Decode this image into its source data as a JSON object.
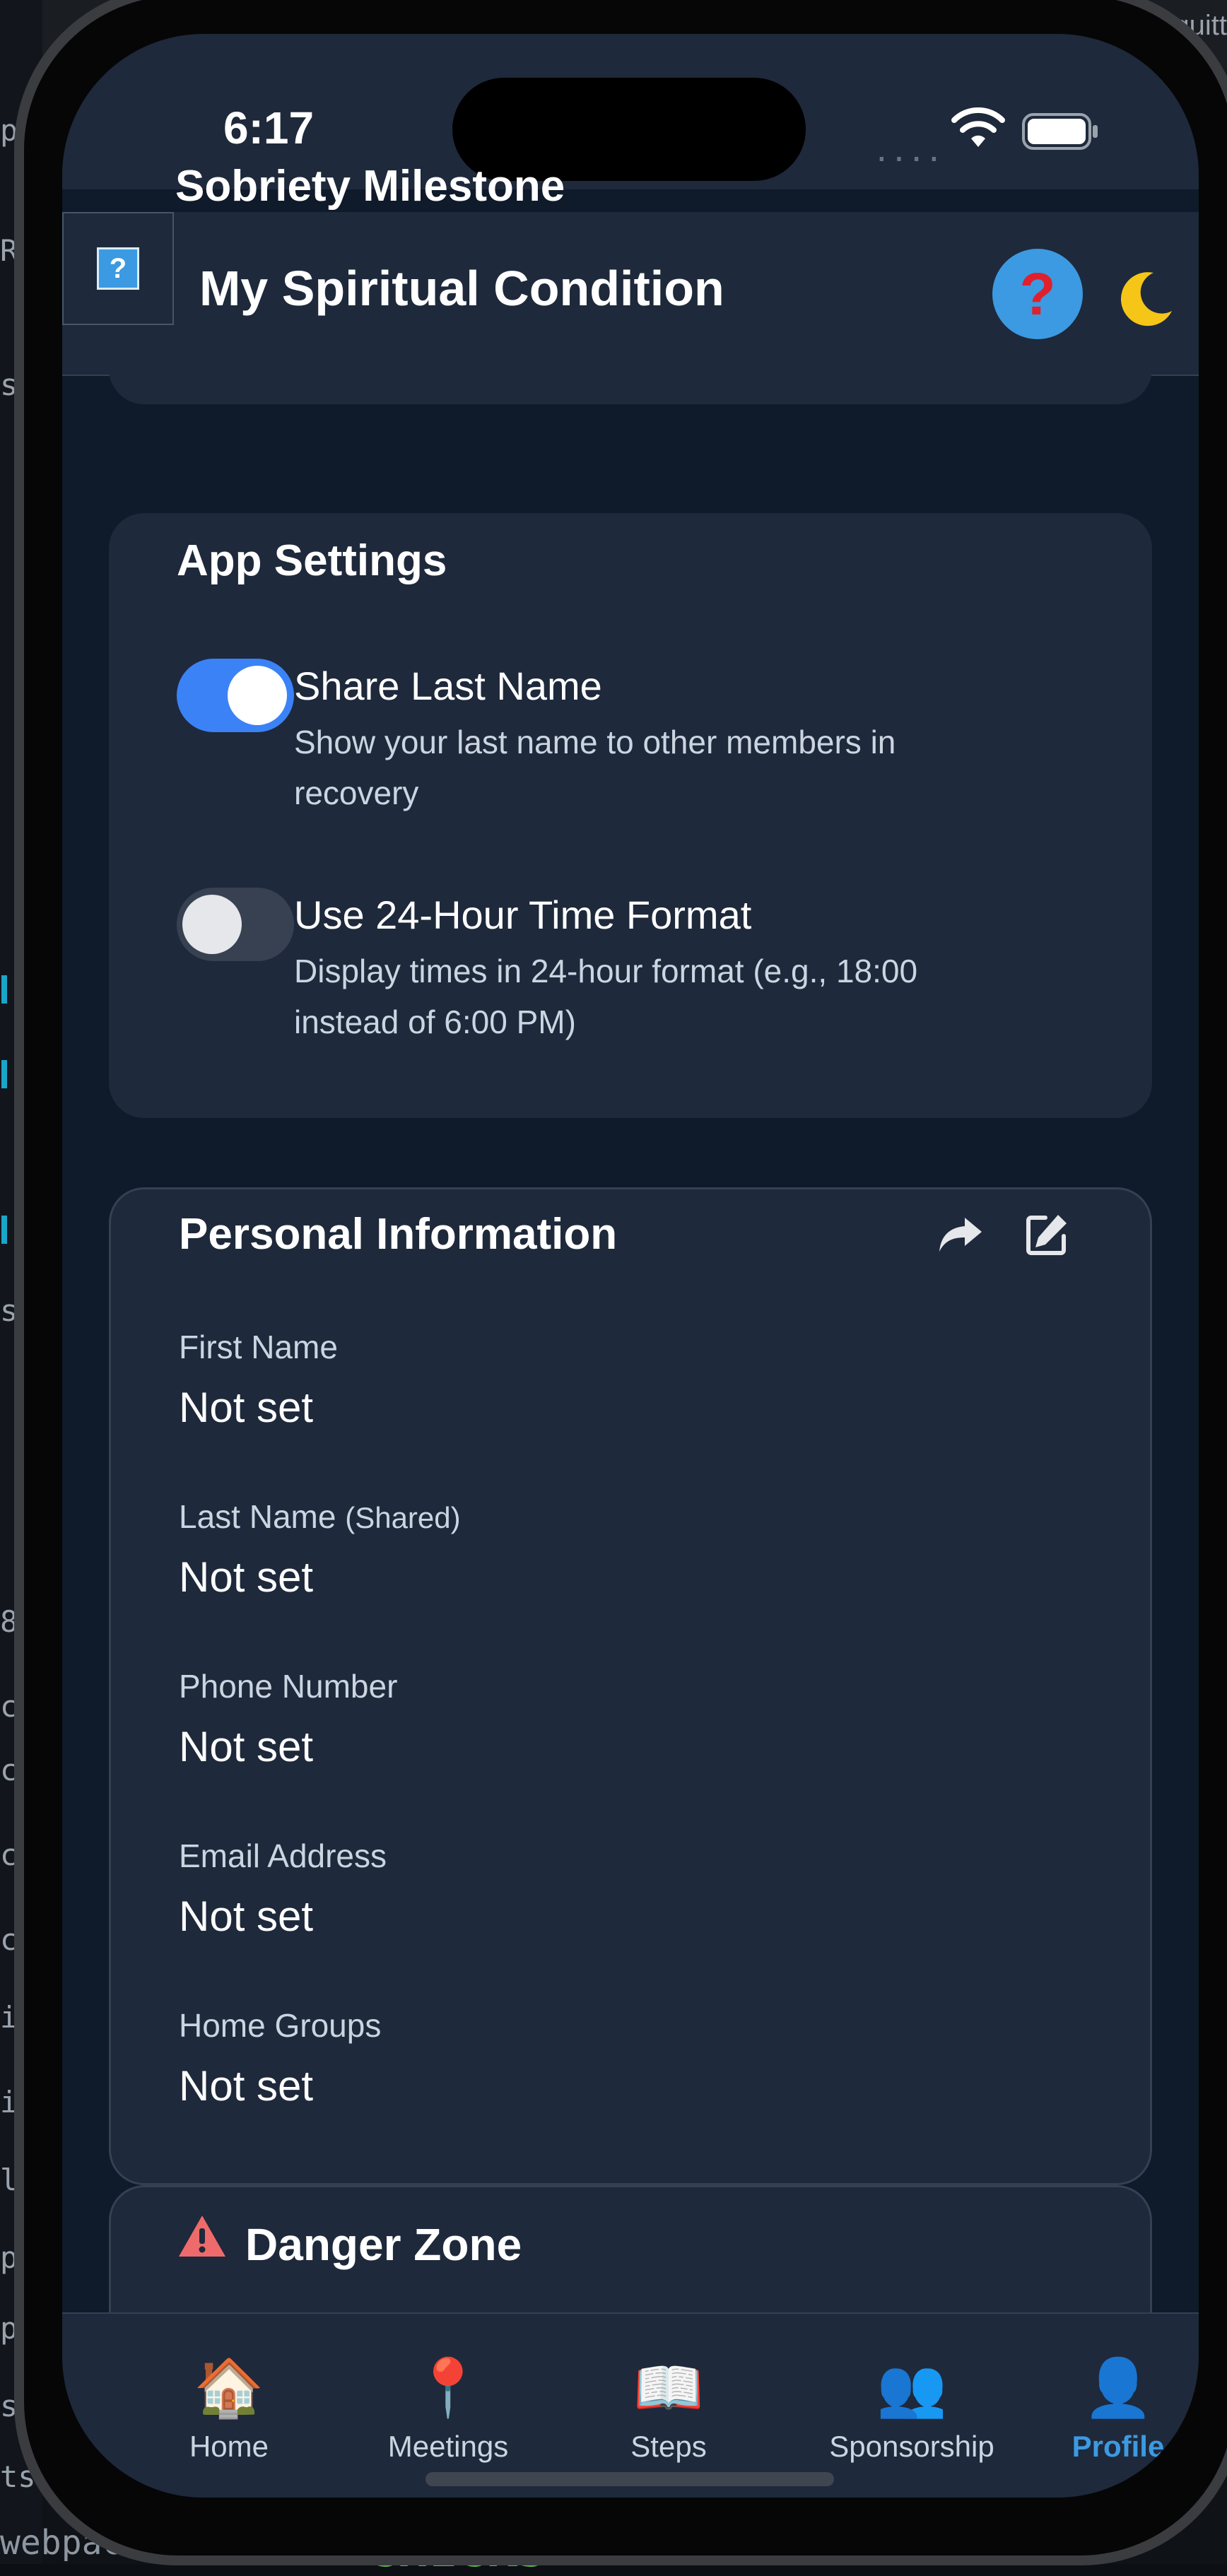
{
  "status_bar": {
    "time": "6:17",
    "signal_dots": "····"
  },
  "partial_header_text": "Sobriety Milestone",
  "app_header": {
    "title": "My Spiritual Condition",
    "help_square_glyph": "?",
    "help_circle_glyph": "?",
    "theme_toggle_icon": "moon-icon"
  },
  "app_settings": {
    "title": "App Settings",
    "items": [
      {
        "label": "Share Last Name",
        "description": "Show your last name to other members in recovery",
        "enabled": true
      },
      {
        "label": "Use 24-Hour Time Format",
        "description": "Display times in 24-hour format (e.g., 18:00 instead of 6:00 PM)",
        "enabled": false
      }
    ]
  },
  "personal_info": {
    "title": "Personal Information",
    "actions": [
      "share-icon",
      "edit-icon"
    ],
    "fields": [
      {
        "label": "First Name",
        "label_suffix": "",
        "value": "Not set"
      },
      {
        "label": "Last Name",
        "label_suffix": "(Shared)",
        "value": "Not set"
      },
      {
        "label": "Phone Number",
        "label_suffix": "",
        "value": "Not set"
      },
      {
        "label": "Email Address",
        "label_suffix": "",
        "value": "Not set"
      },
      {
        "label": "Home Groups",
        "label_suffix": "",
        "value": "Not set"
      }
    ]
  },
  "danger_zone": {
    "title": "Danger Zone"
  },
  "tab_bar": {
    "tabs": [
      {
        "label": "Home",
        "icon": "house-icon",
        "active": false
      },
      {
        "label": "Meetings",
        "icon": "pin-icon",
        "active": false
      },
      {
        "label": "Steps",
        "icon": "book-icon",
        "active": false
      },
      {
        "label": "Sponsorship",
        "icon": "people-icon",
        "active": false
      },
      {
        "label": "Profile",
        "icon": "person-icon",
        "active": true
      }
    ]
  },
  "colors": {
    "accent": "#3b9ae1",
    "toggle_on": "#3b82f6",
    "card_bg": "#1e293b",
    "page_bg": "#0f1a2a",
    "danger": "#ef4444"
  },
  "background": {
    "bottom_left_text": "webpack.con",
    "bottom_green_text": "CHECKS",
    "top_right_text": "esquitt",
    "top_left_text": "pa",
    "left_letters": [
      "R",
      "s",
      "s",
      "8",
      "c",
      "c",
      "c",
      "c",
      "ir",
      "ic",
      "lo",
      "p",
      "p",
      "sc",
      "ts"
    ]
  }
}
